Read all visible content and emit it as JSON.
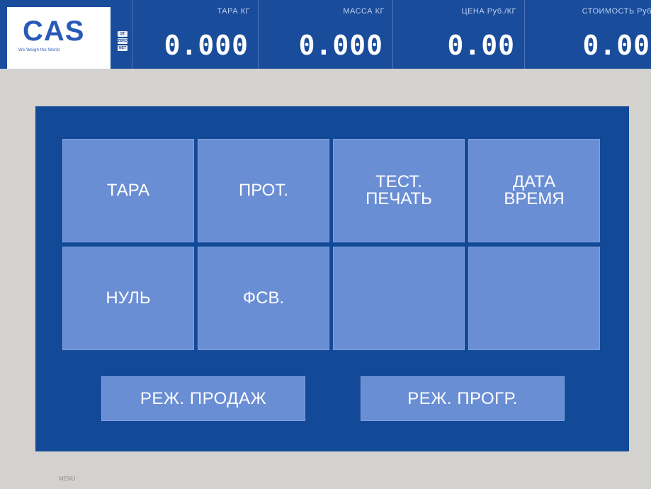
{
  "header": {
    "logo": "CAS",
    "logo_tagline": "We Weigh the World",
    "status_icons": [
      {
        "name": "st-icon",
        "text": "ST"
      },
      {
        "name": "zero-icon",
        "text": "ZERO"
      },
      {
        "name": "net-icon",
        "text": "NET"
      }
    ],
    "fields": [
      {
        "label": "ТАРА  КГ",
        "value": "0.000"
      },
      {
        "label": "МАССА  КГ",
        "value": "0.000"
      },
      {
        "label": "ЦЕНА  Руб./КГ",
        "value": "0.00"
      },
      {
        "label": "СТОИМОСТЬ  Руб",
        "value": "0.00"
      }
    ]
  },
  "keypad": {
    "keys": [
      {
        "label": "ТАРА"
      },
      {
        "label": "ПРОТ."
      },
      {
        "label": "ТЕСТ.\nПЕЧАТЬ"
      },
      {
        "label": "ДАТА\nВРЕМЯ"
      },
      {
        "label": "НУЛЬ"
      },
      {
        "label": "ФСВ."
      },
      {
        "label": ""
      },
      {
        "label": ""
      }
    ]
  },
  "modes": {
    "sales_label": "РЕЖ. ПРОДАЖ",
    "program_label": "РЕЖ. ПРОГР."
  },
  "footer": {
    "text": "MENU"
  },
  "colors": {
    "header_bg": "#1a4c9c",
    "panel_bg": "#134a98",
    "key_bg": "#6a8ed4",
    "page_bg": "#d4d2cf"
  }
}
